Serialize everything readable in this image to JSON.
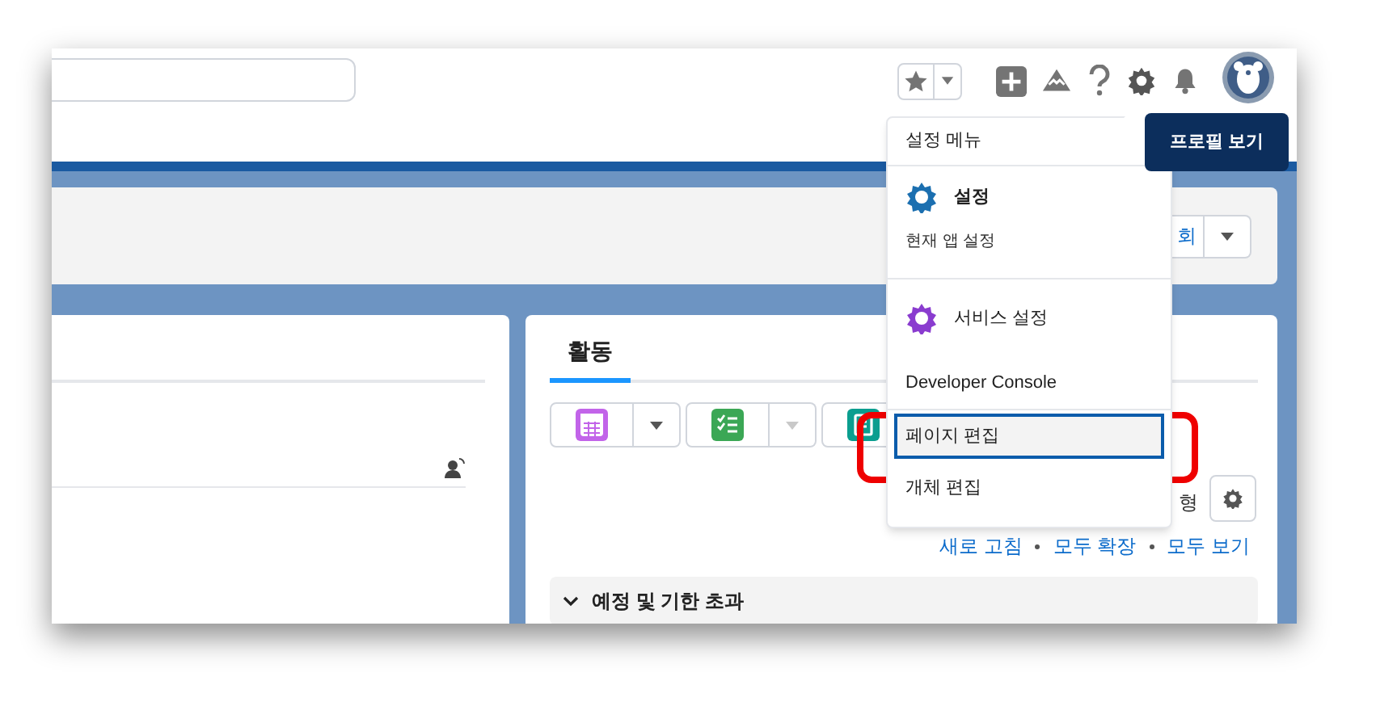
{
  "highlight_panel": {
    "button_label": "회"
  },
  "activity_panel": {
    "tabs": [
      {
        "label": "활동",
        "selected": true
      }
    ],
    "actions": [
      {
        "kind": "calendar",
        "color": "#c264e9",
        "menu_disabled": false
      },
      {
        "kind": "task",
        "color": "#3ba755",
        "menu_disabled": true
      },
      {
        "kind": "note",
        "color": "#0b9e8f"
      }
    ],
    "view_label": "형",
    "links": [
      "새로 고침",
      "모두 확장",
      "모두 보기"
    ],
    "section": {
      "title": "예정 및 기한 초과",
      "expanded": true
    }
  },
  "settings_menu": {
    "title": "설정 메뉴",
    "items": [
      {
        "kind": "app",
        "label": "설정",
        "subtitle": "현재 앱 설정",
        "color": "#1b6fb0",
        "selected": false,
        "divider_after": true
      },
      {
        "kind": "app",
        "label": "서비스 설정",
        "color": "#8a3ccf",
        "selected": false,
        "divider_after": false
      },
      {
        "kind": "plain",
        "label": "Developer Console",
        "selected": false,
        "divider_after": true
      },
      {
        "kind": "plain",
        "label": "페이지 편집",
        "selected": true,
        "divider_after": false
      },
      {
        "kind": "plain",
        "label": "개체 편집",
        "selected": false,
        "divider_after": false
      }
    ]
  },
  "tooltip": {
    "text": "프로필 보기"
  }
}
